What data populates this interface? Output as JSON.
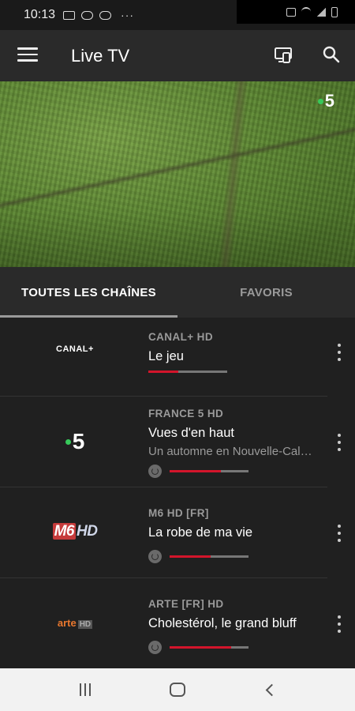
{
  "status_bar": {
    "time": "10:13",
    "icons": [
      "image-icon",
      "voicemail-icon",
      "voicemail-icon",
      "more-dots-icon",
      "mute-icon",
      "wifi-icon",
      "signal-icon",
      "battery-icon"
    ],
    "overflow": "···"
  },
  "app_bar": {
    "title": "Live TV",
    "icons": [
      "menu-icon",
      "cast-icon",
      "search-icon"
    ]
  },
  "hero": {
    "channel_badge": "5"
  },
  "tabs": [
    {
      "label": "TOUTES LES CHAÎNES",
      "active": true
    },
    {
      "label": "FAVORIS",
      "active": false
    }
  ],
  "channels": [
    {
      "logo_text": "CANAL+",
      "name": "CANAL+ HD",
      "program": "Le jeu",
      "next": "",
      "progress": 0.38,
      "replay": false
    },
    {
      "logo_text": "5",
      "name": "FRANCE 5 HD",
      "program": "Vues d'en haut",
      "next": "Un automne en Nouvelle-Calédonie",
      "progress": 0.65,
      "replay": true
    },
    {
      "logo_text_a": "M6",
      "logo_text_b": "HD",
      "name": "M6 HD [FR]",
      "program": "La robe de ma vie",
      "next": "",
      "progress": 0.52,
      "replay": true
    },
    {
      "logo_text_a": "arte",
      "logo_text_b": "HD",
      "name": "ARTE [FR] HD",
      "program": "Cholestérol, le grand bluff",
      "next": "",
      "progress": 0.78,
      "replay": true
    }
  ],
  "colors": {
    "accent_progress": "#d3152b",
    "background": "#202020",
    "appbar": "#2a2a2a",
    "france5_dot": "#37c95a"
  },
  "nav_bar": {
    "icons": [
      "recent-apps-icon",
      "home-icon",
      "back-icon"
    ]
  }
}
